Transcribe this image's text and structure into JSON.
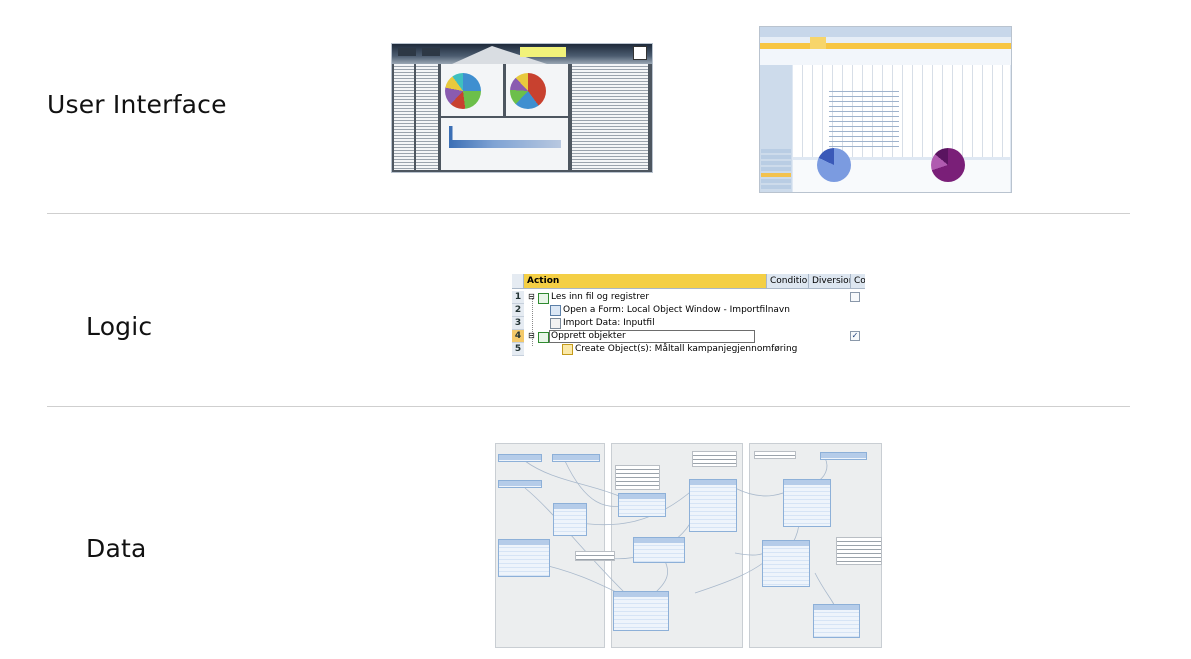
{
  "rows": [
    {
      "label": "User Interface"
    },
    {
      "label": "Logic"
    },
    {
      "label": "Data"
    }
  ],
  "logic": {
    "columns": [
      "Action",
      "Condition",
      "Diversion",
      "Commi"
    ],
    "rows": [
      {
        "num": "1",
        "text": "Les inn fil og registrer",
        "checkbox": true,
        "checked": false
      },
      {
        "num": "2",
        "text": "Open a Form: Local Object Window - Importfilnavn"
      },
      {
        "num": "3",
        "text": "Import Data: Inputfil"
      },
      {
        "num": "4",
        "text": "Opprett objekter",
        "checkbox": true,
        "checked": true,
        "selected": true
      },
      {
        "num": "5",
        "text": "Create Object(s): Måltall kampanjegjennomføring"
      }
    ],
    "checkmark": "✓",
    "collapse_glyph": "−"
  },
  "colors": {
    "accent": "#f4cf45",
    "divider": "#cfcfcf",
    "entity_fill": "#d6e4f5"
  },
  "icons": [
    "group-icon",
    "form-icon",
    "import-icon",
    "create-object-icon"
  ]
}
